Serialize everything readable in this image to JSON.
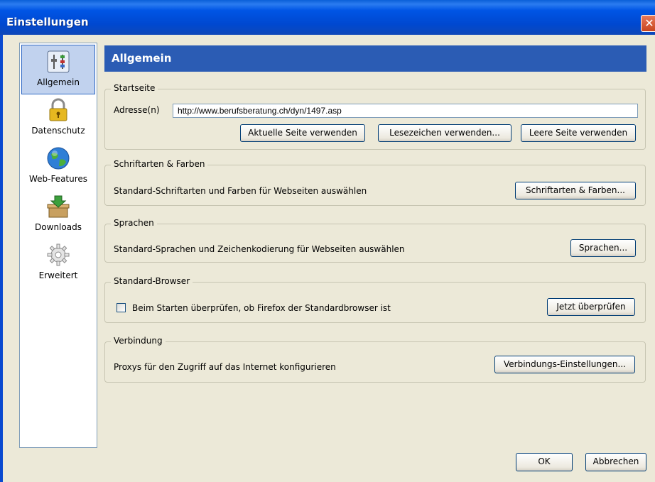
{
  "window": {
    "title": "Einstellungen",
    "close_glyph": "✕"
  },
  "sidebar": {
    "items": [
      {
        "label": "Allgemein",
        "icon": "general-settings-icon"
      },
      {
        "label": "Datenschutz",
        "icon": "padlock-icon"
      },
      {
        "label": "Web-Features",
        "icon": "globe-icon"
      },
      {
        "label": "Downloads",
        "icon": "download-box-icon"
      },
      {
        "label": "Erweitert",
        "icon": "gear-icon"
      }
    ],
    "selected": "Allgemein"
  },
  "main": {
    "title": "Allgemein",
    "startseite": {
      "legend": "Startseite",
      "address_label": "Adresse(n)",
      "address_value": "http://www.berufsberatung.ch/dyn/1497.asp",
      "btn_current": "Aktuelle Seite verwenden",
      "btn_bookmark": "Lesezeichen verwenden...",
      "btn_blank": "Leere Seite verwenden"
    },
    "fonts": {
      "legend": "Schriftarten & Farben",
      "text": "Standard-Schriftarten und Farben für Webseiten auswählen",
      "button": "Schriftarten & Farben..."
    },
    "languages": {
      "legend": "Sprachen",
      "text": "Standard-Sprachen und Zeichenkodierung für Webseiten auswählen",
      "button": "Sprachen..."
    },
    "browser": {
      "legend": "Standard-Browser",
      "checkbox_label": "Beim Starten überprüfen, ob Firefox der Standardbrowser ist",
      "checked": false,
      "button": "Jetzt überprüfen"
    },
    "connection": {
      "legend": "Verbindung",
      "text": "Proxys für den Zugriff auf das Internet konfigurieren",
      "button": "Verbindungs-Einstellungen..."
    }
  },
  "footer": {
    "ok": "OK",
    "cancel": "Abbrechen"
  }
}
